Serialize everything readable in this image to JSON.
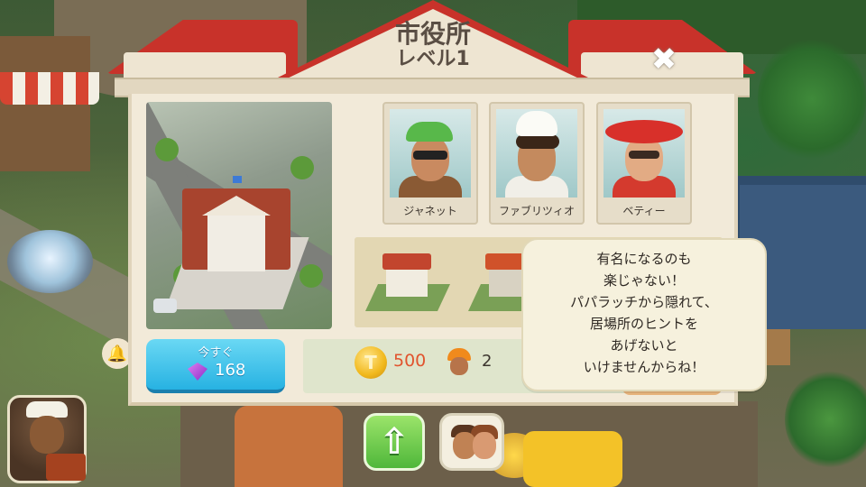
{
  "dialog": {
    "title": "市役所",
    "subtitle": "レベル1",
    "close_icon": "close-icon"
  },
  "characters": [
    {
      "name": "ジャネット"
    },
    {
      "name": "ファブリツィオ"
    },
    {
      "name": "ベティー"
    }
  ],
  "buy_now": {
    "label": "今すぐ",
    "gem_cost": "168",
    "icon": "gem-icon"
  },
  "cost": {
    "coins": "500",
    "coin_glyph": "T",
    "workers": "2",
    "icons": [
      "coin-icon",
      "worker-icon"
    ]
  },
  "speech": {
    "lines": [
      "有名になるのも",
      "楽じゃない！",
      "パパラッチから隠れて、",
      "居場所のヒントを",
      "あげないと",
      "いけませんからね！"
    ]
  },
  "hud": {
    "icons": [
      "captain-avatar",
      "upgrade-arrow-icon",
      "characters-icon"
    ]
  },
  "colors": {
    "roof": "#c8322a",
    "panel": "#f2ead9",
    "buy_button": "#27b2e2",
    "coin_text": "#e1542e",
    "upgrade_button": "#4fb73a"
  }
}
